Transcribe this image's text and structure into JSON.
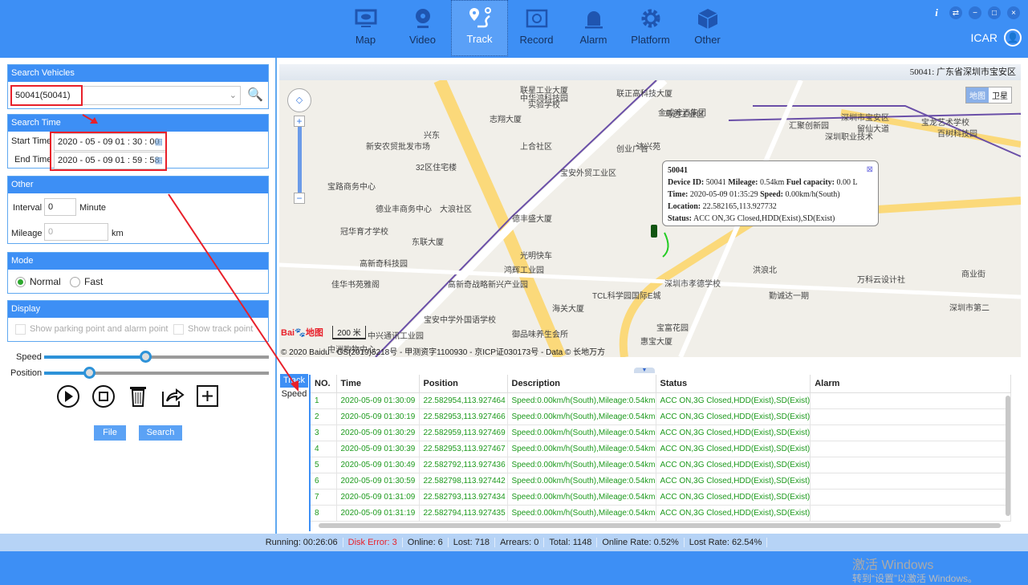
{
  "nav": {
    "items": [
      {
        "label": "Map",
        "icon": "monitor-eye-icon"
      },
      {
        "label": "Video",
        "icon": "webcam-icon"
      },
      {
        "label": "Track",
        "icon": "route-pin-icon",
        "active": true
      },
      {
        "label": "Record",
        "icon": "film-replay-icon"
      },
      {
        "label": "Alarm",
        "icon": "siren-icon"
      },
      {
        "label": "Platform",
        "icon": "gear-icon"
      },
      {
        "label": "Other",
        "icon": "cube-icon"
      }
    ],
    "user": "ICAR",
    "window_controls": [
      "i",
      "⇄",
      "−",
      "□",
      "×"
    ]
  },
  "search_vehicles": {
    "title": "Search Vehicles",
    "value": "50041(50041)"
  },
  "search_time": {
    "title": "Search Time",
    "start_label": "Start Time",
    "start": "2020 - 05 - 09  01 : 30 : 00",
    "end_label": "End Time",
    "end": "2020 - 05 - 09  01 : 59 : 58"
  },
  "other": {
    "title": "Other",
    "interval_label": "Interval",
    "interval": "0",
    "interval_unit": "Minute",
    "mileage_label": "Mileage",
    "mileage_placeholder": "0",
    "mileage_unit": "km"
  },
  "mode": {
    "title": "Mode",
    "options": [
      "Normal",
      "Fast"
    ],
    "selected": "Normal"
  },
  "display": {
    "title": "Display",
    "options": [
      "Show parking point and alarm point",
      "Show track point"
    ]
  },
  "playback": {
    "speed_label": "Speed",
    "speed_percent": 45,
    "position_label": "Position",
    "position_percent": 20,
    "file_button": "File",
    "search_button": "Search"
  },
  "map": {
    "header": "50041: 广东省深圳市宝安区",
    "map_type": [
      "地图",
      "卫星"
    ],
    "scale": "200 米",
    "copyright": "© 2020 Baidu - GS(2019)5218号 - 甲测资字1100930 - 京ICP证030173号 - Data © 长地万方",
    "logo": "Bai du 地图",
    "labels": [
      "联星工业大厦",
      "联正高科技大厦",
      "中华鸿科技园",
      "实验学校",
      "志翔大厦",
      "马边工业区",
      "金威啤酒集团",
      "汇聚创新园",
      "留仙大道",
      "深圳职业技术",
      "深圳市宝安区",
      "宝龙艺术学校",
      "百树科技园",
      "兴东",
      "新安农贸批发市场",
      "上合社区",
      "创业广告",
      "达兴苑",
      "32区住宅楼",
      "宝安外贸工业区",
      "宝路商务中心",
      "德业丰商务中心",
      "大浪社区",
      "德丰盛大厦",
      "冠华育才学校",
      "东联大厦",
      "光明快车",
      "高新奇科技园",
      "鸿辉工业园",
      "深圳市孝德学校",
      "洪浪北",
      "佳华书苑雅阁",
      "高新奇战略新兴产业园",
      "TCL科学园国际E城",
      "宝富花园",
      "勤诚达一期",
      "海关大厦",
      "宝安中学外国语学校",
      "御品味养生会所",
      "惠宝大厦",
      "中洲购物中心",
      "中兴通讯工业园",
      "万科云设计社",
      "商业街",
      "深圳市第二"
    ],
    "popup": {
      "title": "50041",
      "device_id_label": "Device ID:",
      "device_id": "50041",
      "mileage_label": "Mileage:",
      "mileage": "0.54km",
      "fuel_label": "Fuel capacity:",
      "fuel": "0.00 L",
      "time_label": "Time:",
      "time": "2020-05-09 01:35:29",
      "speed_label": "Speed:",
      "speed": "0.00km/h(South)",
      "location_label": "Location:",
      "location": "22.582165,113.927732",
      "status_label": "Status:",
      "status": "ACC ON,3G Closed,HDD(Exist),SD(Exist)"
    }
  },
  "bottom_tabs": [
    "Track",
    "Speed"
  ],
  "table": {
    "columns": [
      "NO.",
      "Time",
      "Position",
      "Description",
      "Status",
      "Alarm"
    ],
    "rows": [
      [
        "1",
        "2020-05-09 01:30:09",
        "22.582954,113.927464",
        "Speed:0.00km/h(South),Mileage:0.54km",
        "ACC ON,3G Closed,HDD(Exist),SD(Exist)",
        ""
      ],
      [
        "2",
        "2020-05-09 01:30:19",
        "22.582953,113.927466",
        "Speed:0.00km/h(South),Mileage:0.54km",
        "ACC ON,3G Closed,HDD(Exist),SD(Exist)",
        ""
      ],
      [
        "3",
        "2020-05-09 01:30:29",
        "22.582959,113.927469",
        "Speed:0.00km/h(South),Mileage:0.54km",
        "ACC ON,3G Closed,HDD(Exist),SD(Exist)",
        ""
      ],
      [
        "4",
        "2020-05-09 01:30:39",
        "22.582953,113.927467",
        "Speed:0.00km/h(South),Mileage:0.54km",
        "ACC ON,3G Closed,HDD(Exist),SD(Exist)",
        ""
      ],
      [
        "5",
        "2020-05-09 01:30:49",
        "22.582792,113.927436",
        "Speed:0.00km/h(South),Mileage:0.54km",
        "ACC ON,3G Closed,HDD(Exist),SD(Exist)",
        ""
      ],
      [
        "6",
        "2020-05-09 01:30:59",
        "22.582798,113.927442",
        "Speed:0.00km/h(South),Mileage:0.54km",
        "ACC ON,3G Closed,HDD(Exist),SD(Exist)",
        ""
      ],
      [
        "7",
        "2020-05-09 01:31:09",
        "22.582793,113.927434",
        "Speed:0.00km/h(South),Mileage:0.54km",
        "ACC ON,3G Closed,HDD(Exist),SD(Exist)",
        ""
      ],
      [
        "8",
        "2020-05-09 01:31:19",
        "22.582794,113.927435",
        "Speed:0.00km/h(South),Mileage:0.54km",
        "ACC ON,3G Closed,HDD(Exist),SD(Exist)",
        ""
      ]
    ]
  },
  "status_bar": [
    {
      "text": "Running:  00:26:06"
    },
    {
      "text": "Disk Error:  3",
      "color": "#e8202a"
    },
    {
      "text": "Online:  6"
    },
    {
      "text": "Lost:  718"
    },
    {
      "text": "Arrears:  0"
    },
    {
      "text": "Total:  1148"
    },
    {
      "text": "Online Rate:  0.52%"
    },
    {
      "text": "Lost Rate:  62.54%"
    }
  ],
  "watermark": [
    "激活 Windows",
    "转到“设置”以激活 Windows。"
  ]
}
